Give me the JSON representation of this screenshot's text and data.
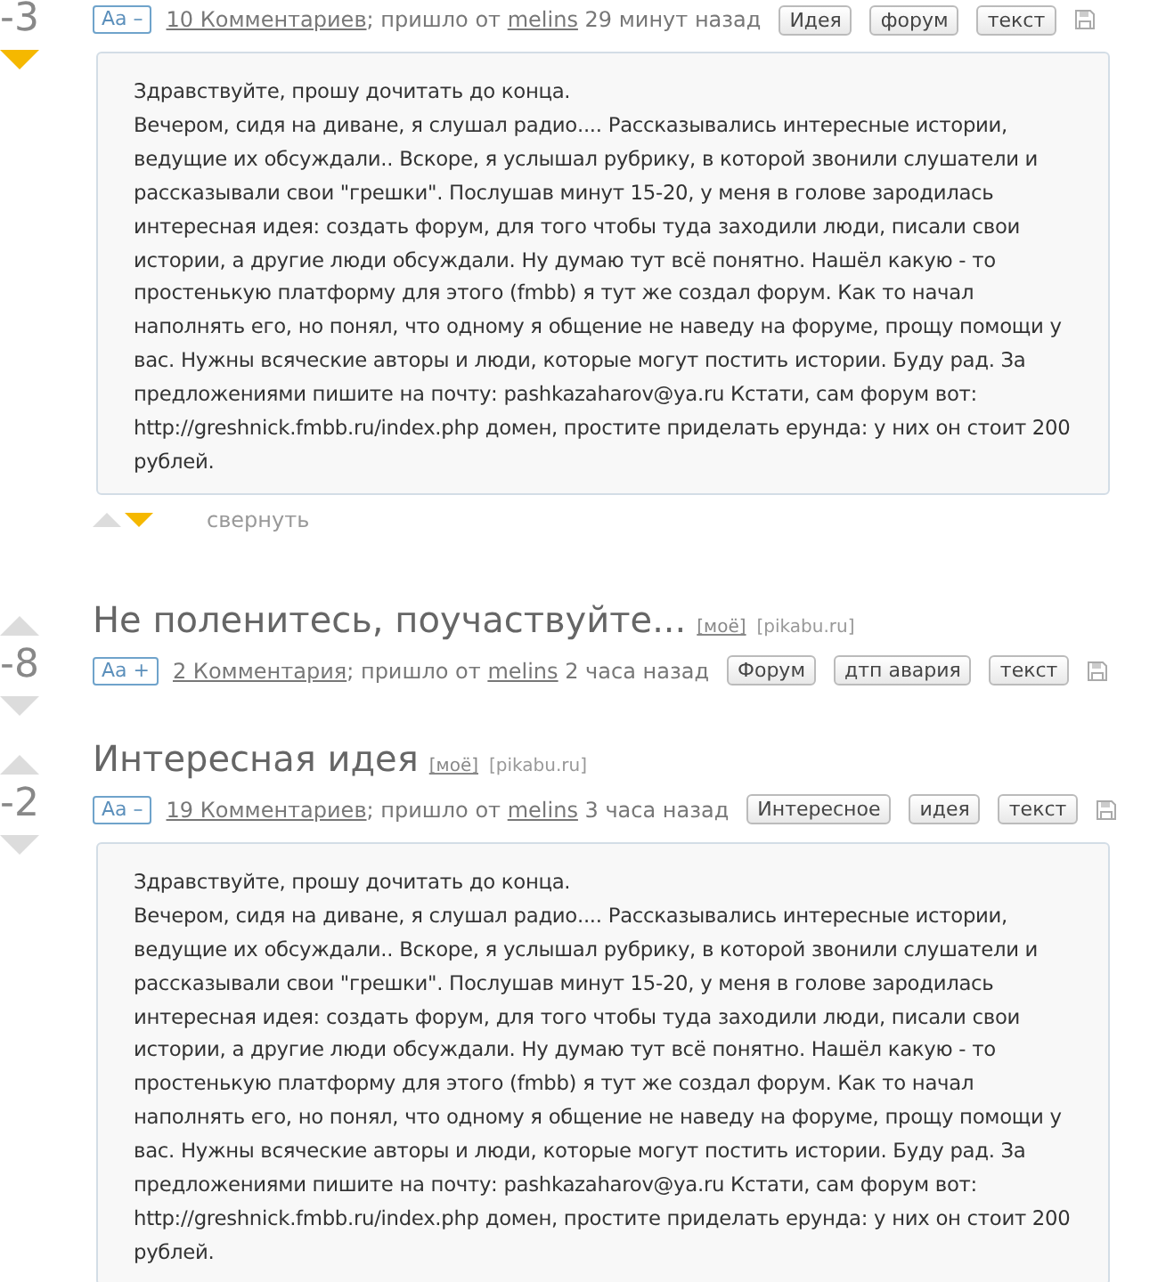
{
  "posts": [
    {
      "rating": "-3",
      "voted_down": true,
      "font_toggle": "Aa –",
      "comments": "10 Комментариев",
      "via": "; пришло от",
      "author": "melins",
      "time": "29 минут назад",
      "tags": [
        "Идея",
        "форум",
        "текст"
      ],
      "body": [
        "Здравствуйте, прошу дочитать до конца.",
        "Вечером, сидя на диване, я слушал радио.... Рассказывались интересные истории, ведущие их обсуждали.. Вскоре, я услышал рубрику, в которой звонили слушатели и рассказывали свои \"грешки\". Послушав минут 15-20, у меня в голове зародилась интересная идея: создать форум, для того чтобы туда заходили люди, писали свои истории, а другие люди обсуждали. Ну думаю тут всё понятно. Нашёл какую - то простенькую платформу для этого (fmbb) я тут же создал форум. Как то начал наполнять его, но понял, что одному я общение не наведу на форуме, прощу помощи у вас. Нужны всяческие авторы и люди, которые могут постить истории. Буду рад. За предложениями пишите на почту: pashkazaharov@ya.ru Кстати, сам форум вот: http://greshnick.fmbb.ru/index.php домен, простите приделать ерунда: у них он стоит 200 рублей."
      ],
      "collapse": "свернуть"
    },
    {
      "rating": "-8",
      "voted_down": false,
      "title": "Не поленитесь, поучаствуйте...",
      "mine": "[моё]",
      "source": "[pikabu.ru]",
      "font_toggle": "Aa +",
      "comments": "2 Комментария",
      "via": "; пришло от",
      "author": "melins",
      "time": "2 часа назад",
      "tags": [
        "Форум",
        "дтп авария",
        "текст"
      ]
    },
    {
      "rating": "-2",
      "voted_down": false,
      "title": "Интересная идея",
      "mine": "[моё]",
      "source": "[pikabu.ru]",
      "font_toggle": "Aa –",
      "comments": "19 Комментариев",
      "via": "; пришло от",
      "author": "melins",
      "time": "3 часа назад",
      "tags": [
        "Интересное",
        "идея",
        "текст"
      ],
      "body": [
        "Здравствуйте, прошу дочитать до конца.",
        "Вечером, сидя на диване, я слушал радио.... Рассказывались интересные истории, ведущие их обсуждали.. Вскоре, я услышал рубрику, в которой звонили слушатели и рассказывали свои \"грешки\". Послушав минут 15-20, у меня в голове зародилась интересная идея: создать форум, для того чтобы туда заходили люди, писали свои истории, а другие люди обсуждали. Ну думаю тут всё понятно. Нашёл какую - то простенькую платформу для этого (fmbb) я тут же создал форум. Как то начал наполнять его, но понял, что одному я общение не наведу на форуме, прощу помощи у вас. Нужны всяческие авторы и люди, которые могут постить истории. Буду рад. За предложениями пишите на почту: pashkazaharov@ya.ru Кстати, сам форум вот: http://greshnick.fmbb.ru/index.php домен, простите приделать ерунда: у них он стоит 200 рублей."
      ]
    }
  ]
}
